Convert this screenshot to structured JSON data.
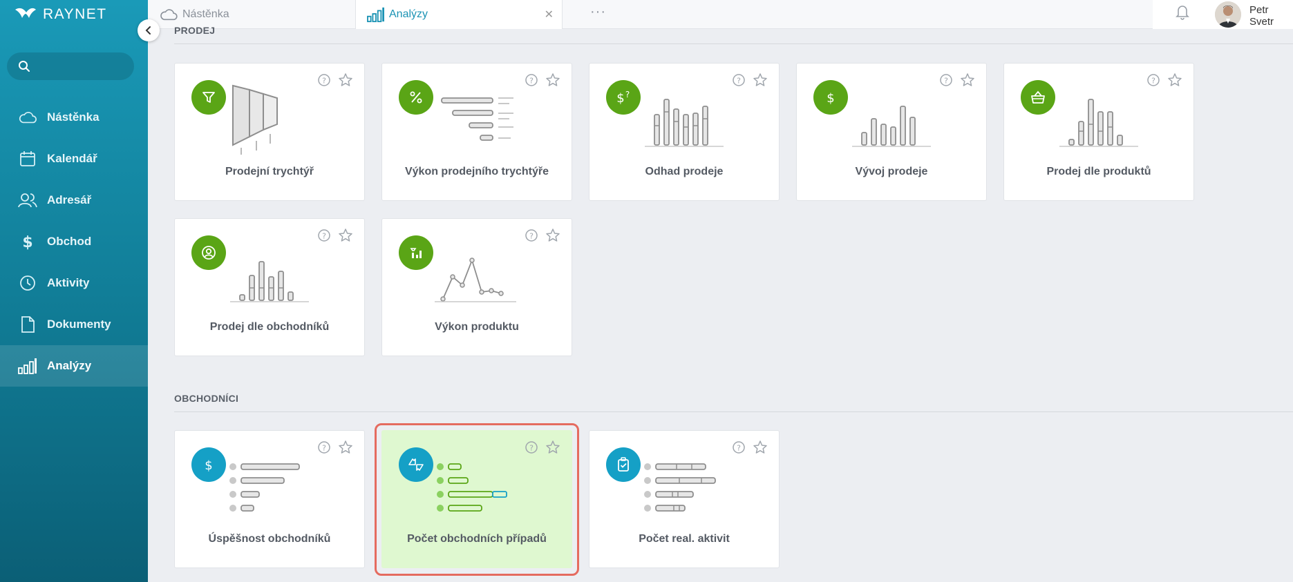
{
  "app": {
    "logo_text": "RAYNET"
  },
  "search": {
    "placeholder": ""
  },
  "sidebar": {
    "items": [
      {
        "label": "Nástěnka",
        "icon": "cloud-icon"
      },
      {
        "label": "Kalendář",
        "icon": "calendar-icon"
      },
      {
        "label": "Adresář",
        "icon": "contacts-icon"
      },
      {
        "label": "Obchod",
        "icon": "dollar-icon"
      },
      {
        "label": "Aktivity",
        "icon": "clock-icon"
      },
      {
        "label": "Dokumenty",
        "icon": "document-icon"
      },
      {
        "label": "Analýzy",
        "icon": "bar-chart-icon",
        "active": true
      }
    ]
  },
  "tabs": [
    {
      "label": "Nástěnka",
      "icon": "cloud-icon"
    },
    {
      "label": "Analýzy",
      "icon": "bar-chart-icon",
      "active": true
    }
  ],
  "user": {
    "name": "Petr Svetr"
  },
  "sections": [
    {
      "title": "PRODEJ",
      "cards": [
        {
          "label": "Prodejní trychtýř",
          "icon": "funnel-icon"
        },
        {
          "label": "Výkon prodejního trychtýře",
          "icon": "percent-icon"
        },
        {
          "label": "Odhad prodeje",
          "icon": "dollar-question-icon"
        },
        {
          "label": "Vývoj prodeje",
          "icon": "dollar-icon"
        },
        {
          "label": "Prodej dle produktů",
          "icon": "basket-icon"
        },
        {
          "label": "Prodej dle obchodníků",
          "icon": "user-circle-icon"
        },
        {
          "label": "Výkon produktu",
          "icon": "product-chart-icon"
        }
      ]
    },
    {
      "title": "OBCHODNÍCI",
      "cards": [
        {
          "label": "Úspěšnost obchodníků",
          "icon": "dollar-icon"
        },
        {
          "label": "Počet obchodních případů",
          "icon": "handshake-icon",
          "highlighted": true
        },
        {
          "label": "Počet real. aktivit",
          "icon": "clipboard-check-icon"
        }
      ]
    }
  ],
  "colors": {
    "accent": "#1b93b4",
    "green": "#5aa516",
    "blue": "#15a0c6",
    "highlight": "#dff8d0",
    "ring": "#e56b5f"
  }
}
